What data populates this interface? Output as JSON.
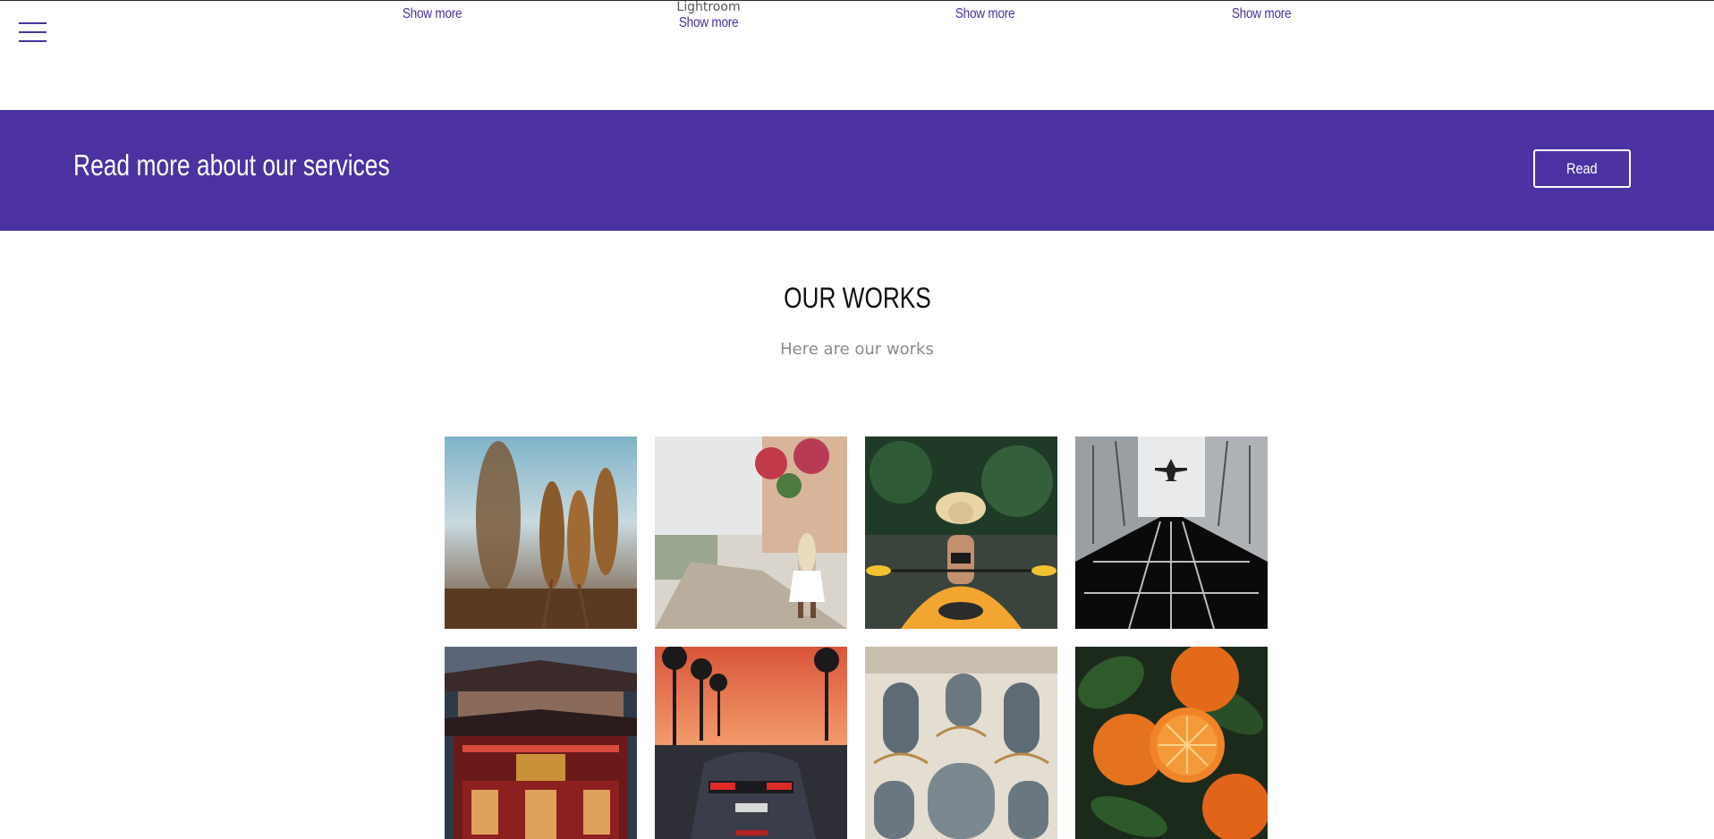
{
  "top_services": [
    {
      "tag": "",
      "link": "Show more"
    },
    {
      "tag": "Lightroom",
      "link": "Show more"
    },
    {
      "tag": "",
      "link": "Show more"
    },
    {
      "tag": "",
      "link": "Show more"
    }
  ],
  "banner": {
    "title": "Read more about our services",
    "button_label": "Read",
    "color": "#4b32a0"
  },
  "works": {
    "title": "OUR WORKS",
    "subtitle": "Here are our works",
    "items": [
      {
        "name": "wheat-photo"
      },
      {
        "name": "woman-walking-photo"
      },
      {
        "name": "kayak-photo"
      },
      {
        "name": "airplane-building-photo"
      },
      {
        "name": "temple-photo"
      },
      {
        "name": "sports-car-photo"
      },
      {
        "name": "baroque-interior-photo"
      },
      {
        "name": "oranges-photo"
      }
    ]
  },
  "icons": {
    "menu": "hamburger-menu-icon"
  }
}
